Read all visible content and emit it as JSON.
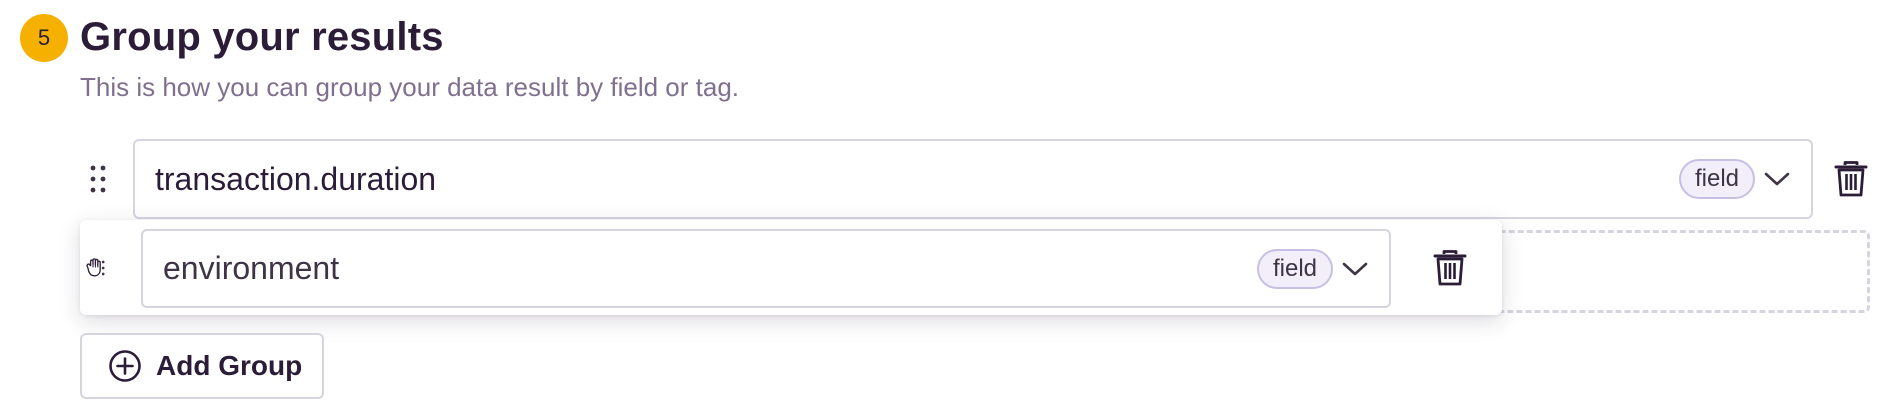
{
  "step": {
    "number": "5",
    "color": "#f5b000"
  },
  "section": {
    "title": "Group your results",
    "subtitle": "This is how you can group your data result by field or tag."
  },
  "groups": [
    {
      "value": "transaction.duration",
      "kind": "field"
    },
    {
      "value": "environment",
      "kind": "field",
      "dragging": true
    }
  ],
  "actions": {
    "add_group_label": "Add Group"
  },
  "icons": {
    "drag_handle": "drag-handle-icon",
    "grab_cursor": "grab-hand-icon",
    "chevron": "chevron-down-icon",
    "delete": "trash-icon",
    "add": "plus-circle-icon"
  }
}
